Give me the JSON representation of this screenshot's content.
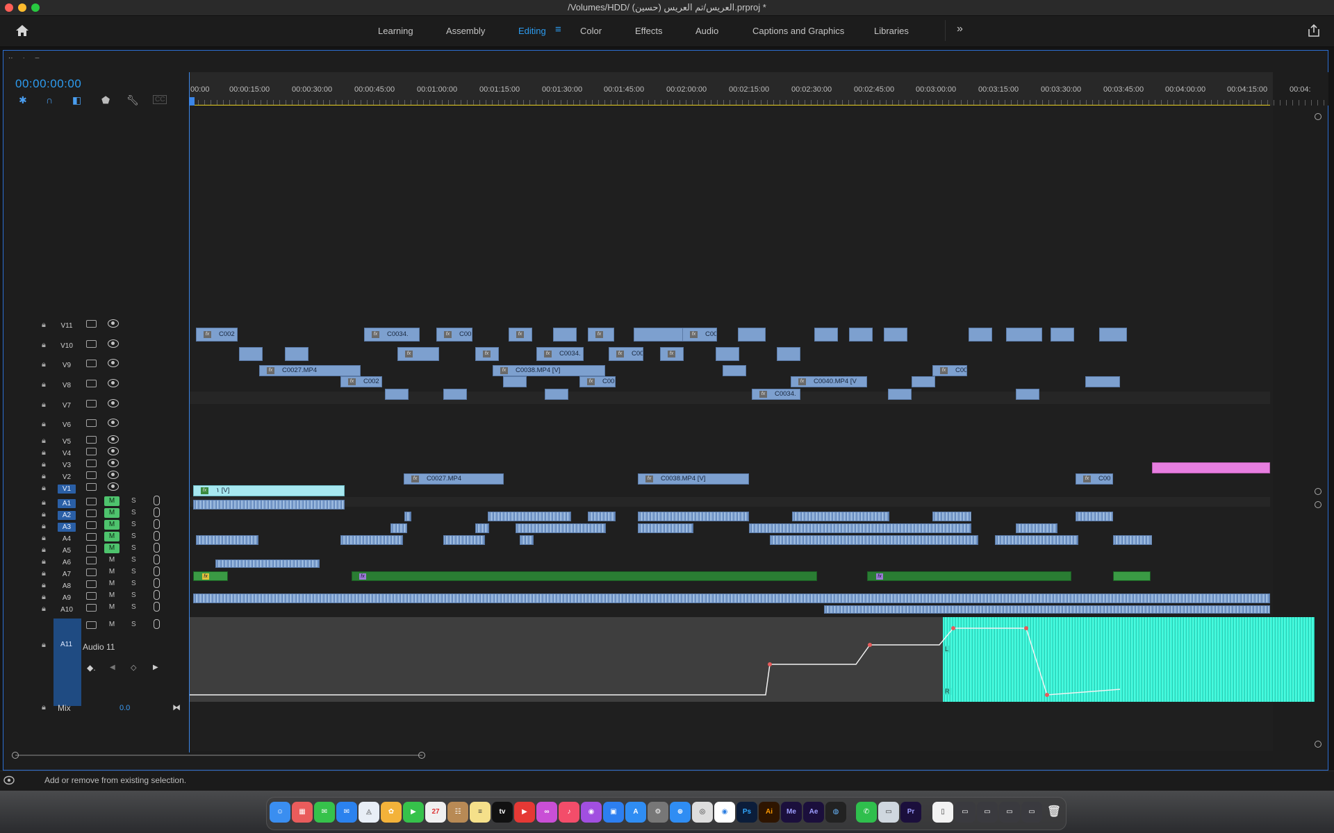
{
  "window": {
    "title": "/Volumes/HDD/ العريس/تم العريس (حسين).prproj *"
  },
  "workspaces": {
    "tabs": [
      {
        "label": "Learning",
        "active": false
      },
      {
        "label": "Assembly",
        "active": false
      },
      {
        "label": "Editing",
        "active": true
      },
      {
        "label": "Color",
        "active": false
      },
      {
        "label": "Effects",
        "active": false
      },
      {
        "label": "Audio",
        "active": false
      },
      {
        "label": "Captions and Graphics",
        "active": false
      },
      {
        "label": "Libraries",
        "active": false
      }
    ],
    "overflow_label": "»"
  },
  "sequence": {
    "tab_label": "١",
    "timecode": "00:00:00:00"
  },
  "ruler": {
    "labels": [
      "00:00",
      "00:00:15:00",
      "00:00:30:00",
      "00:00:45:00",
      "00:01:00:00",
      "00:01:15:00",
      "00:01:30:00",
      "00:01:45:00",
      "00:02:00:00",
      "00:02:15:00",
      "00:02:30:00",
      "00:02:45:00",
      "00:03:00:00",
      "00:03:15:00",
      "00:03:30:00",
      "00:03:45:00",
      "00:04:00:00",
      "00:04:15:00",
      "00:04:"
    ]
  },
  "video_tracks": [
    {
      "name": "V11",
      "targeted": false
    },
    {
      "name": "V10",
      "targeted": false
    },
    {
      "name": "V9",
      "targeted": false
    },
    {
      "name": "V8",
      "targeted": false
    },
    {
      "name": "V7",
      "targeted": false
    },
    {
      "name": "V6",
      "targeted": false
    },
    {
      "name": "V5",
      "targeted": false
    },
    {
      "name": "V4",
      "targeted": false
    },
    {
      "name": "V3",
      "targeted": false
    },
    {
      "name": "V2",
      "targeted": false
    },
    {
      "name": "V1",
      "targeted": true
    }
  ],
  "audio_tracks": [
    {
      "name": "A1",
      "targeted": true,
      "muted": true
    },
    {
      "name": "A2",
      "targeted": true,
      "muted": true
    },
    {
      "name": "A3",
      "targeted": true,
      "muted": true
    },
    {
      "name": "A4",
      "targeted": false,
      "muted": true
    },
    {
      "name": "A5",
      "targeted": false,
      "muted": true
    },
    {
      "name": "A6",
      "targeted": false,
      "muted": false
    },
    {
      "name": "A7",
      "targeted": false,
      "muted": false
    },
    {
      "name": "A8",
      "targeted": false,
      "muted": false
    },
    {
      "name": "A9",
      "targeted": false,
      "muted": false
    },
    {
      "name": "A10",
      "targeted": false,
      "muted": false
    }
  ],
  "audio11": {
    "name": "A11",
    "label": "Audio 11"
  },
  "mix": {
    "label": "Mix",
    "value": "0.0"
  },
  "track_controls": {
    "mute": "M",
    "solo": "S"
  },
  "clips": {
    "v7": [
      "C002",
      "C0034.",
      "C00",
      "C00"
    ],
    "v6": [
      "C0034.",
      "C00"
    ],
    "v5": [
      "C0027.MP4",
      "C0038.MP4 [V]",
      "C00"
    ],
    "v4": [
      "C002",
      "C00",
      "C0040.MP4 [V"
    ],
    "v3": [
      "C0034."
    ],
    "v2": [
      "C0027.MP4",
      "C0038.MP4 [V]",
      "C00"
    ],
    "v1": [
      "١ [V]"
    ]
  },
  "status": {
    "text": "Add or remove from existing selection."
  }
}
